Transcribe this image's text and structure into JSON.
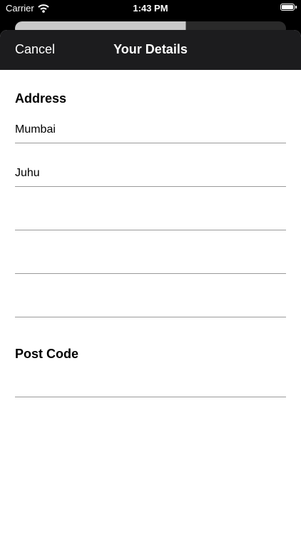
{
  "status_bar": {
    "carrier": "Carrier",
    "time": "1:43 PM"
  },
  "nav": {
    "cancel_label": "Cancel",
    "title": "Your Details"
  },
  "address": {
    "title": "Address",
    "lines": [
      "Mumbai",
      "Juhu",
      "",
      "",
      ""
    ]
  },
  "post_code": {
    "title": "Post Code",
    "value": ""
  }
}
